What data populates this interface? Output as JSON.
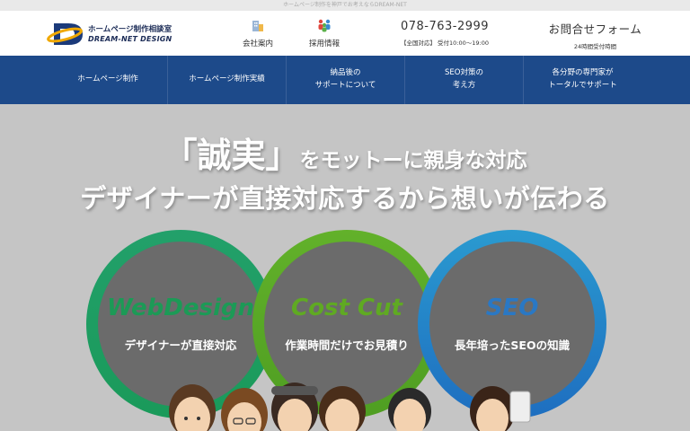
{
  "tagline": "ホームページ制作を神戸でお考えならDREAM-NET",
  "logo": {
    "name_jp": "ホームページ制作相談室",
    "name_en": "DREAM-NET DESIGN"
  },
  "header": {
    "company_label": "会社案内",
    "recruit_label": "採用情報",
    "phone": "078-763-2999",
    "phone_hours": "【全国対応】 受付10:00〜19:00",
    "contact_label": "お問合せフォーム",
    "contact_sub": "24時間受付時間"
  },
  "nav": [
    {
      "label": "ホームページ制作"
    },
    {
      "label": "ホームページ制作実績"
    },
    {
      "label": "納品後の\nサポートについて"
    },
    {
      "label": "SEO対策の\n考え方"
    },
    {
      "label": "各分野の専門家が\nトータルでサポート"
    }
  ],
  "hero": {
    "line1_quote": "「誠実」",
    "line1_rest": "をモットーに親身な対応",
    "line2": "デザイナーが直接対応するから想いが伝わる",
    "circles": [
      {
        "title": "WebDesign",
        "desc": "デザイナーが直接対応",
        "title_color": "#1c9a56"
      },
      {
        "title": "Cost Cut",
        "desc": "作業時間だけでお見積り",
        "title_color": "#5faa22"
      },
      {
        "title": "SEO",
        "desc": "長年培ったSEOの知識",
        "title_color": "#2a78c4"
      }
    ]
  },
  "colors": {
    "nav_bg": "#1d4a8a",
    "hero_bg": "#c5c5c5",
    "circle_fill": "#6b6b6b"
  }
}
